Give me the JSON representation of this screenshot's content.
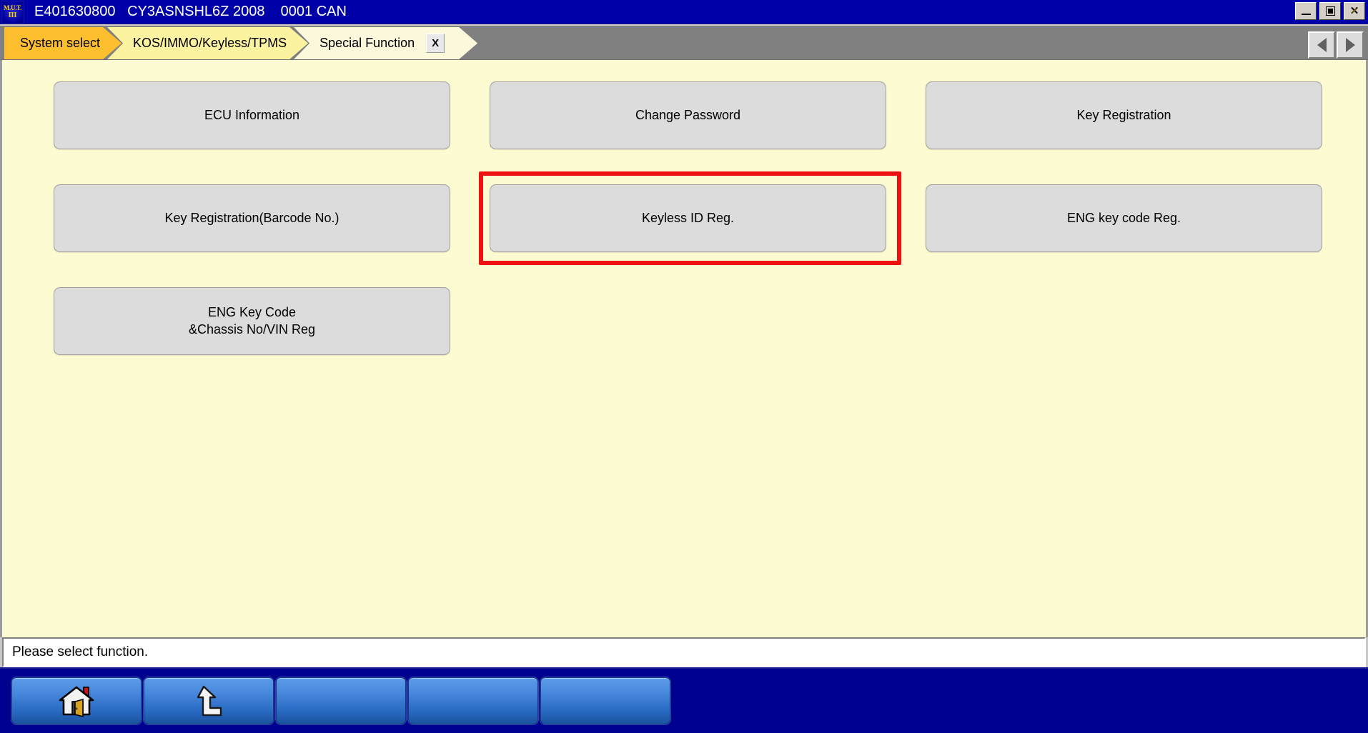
{
  "window": {
    "logo_line1": "M.U.T.",
    "logo_line2": "III",
    "title": "E401630800   CY3ASNSHL6Z 2008    0001 CAN",
    "controls": {
      "minimize": "minimize-button",
      "maximize": "maximize-button",
      "close": "✕"
    }
  },
  "tabs": {
    "items": [
      {
        "label": "System select",
        "state": "inactive",
        "color": "#fdbf2d"
      },
      {
        "label": "KOS/IMMO/Keyless/TPMS",
        "state": "inactive",
        "color": "#fbf3a0"
      },
      {
        "label": "Special Function",
        "state": "active",
        "color": "#fbf8db",
        "close_label": "X"
      }
    ],
    "nav_prev": "prev-page",
    "nav_next": "next-page"
  },
  "main": {
    "background": "#fdfbd2",
    "buttons": [
      {
        "label": "ECU Information",
        "row": 1,
        "col": 1,
        "highlighted": false
      },
      {
        "label": "Change Password",
        "row": 1,
        "col": 2,
        "highlighted": false
      },
      {
        "label": "Key Registration",
        "row": 1,
        "col": 3,
        "highlighted": false
      },
      {
        "label": "Key Registration(Barcode No.)",
        "row": 2,
        "col": 1,
        "highlighted": false
      },
      {
        "label": "Keyless ID Reg.",
        "row": 2,
        "col": 2,
        "highlighted": true
      },
      {
        "label": "ENG key code Reg.",
        "row": 2,
        "col": 3,
        "highlighted": false
      },
      {
        "label": "ENG Key Code\n&Chassis No/VIN Reg",
        "row": 3,
        "col": 1,
        "highlighted": false
      }
    ],
    "highlight_color": "#ee1111"
  },
  "status": {
    "message": "Please select function."
  },
  "toolbar": {
    "buttons": [
      {
        "icon": "home-icon",
        "label": ""
      },
      {
        "icon": "back-up-icon",
        "label": ""
      },
      {
        "icon": "",
        "label": ""
      },
      {
        "icon": "",
        "label": ""
      },
      {
        "icon": "",
        "label": ""
      }
    ]
  }
}
